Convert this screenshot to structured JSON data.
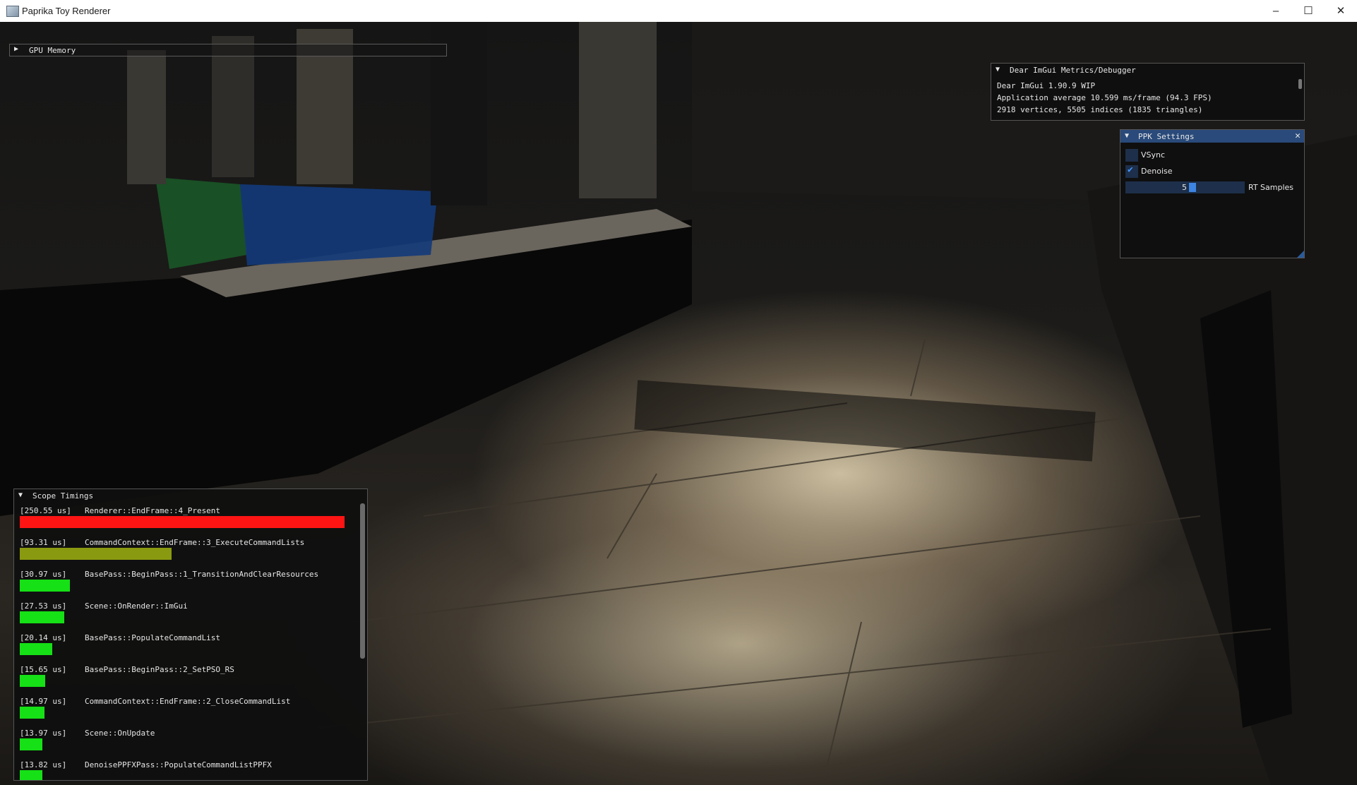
{
  "window": {
    "title": "Paprika Toy Renderer",
    "minimize_glyph": "–",
    "maximize_glyph": "☐",
    "close_glyph": "✕"
  },
  "gpu_memory": {
    "arrow": "▶",
    "label": "GPU Memory"
  },
  "metrics": {
    "arrow": "▼",
    "title": "Dear ImGui Metrics/Debugger",
    "lines": [
      "Dear ImGui 1.90.9 WIP",
      "Application average 10.599 ms/frame (94.3 FPS)",
      "2918 vertices, 5505 indices (1835 triangles)"
    ]
  },
  "ppk_settings": {
    "arrow": "▼",
    "title": "PPK Settings",
    "close": "✕",
    "vsync_label": "VSync",
    "vsync_checked": false,
    "denoise_label": "Denoise",
    "denoise_checked": true,
    "check_glyph": "✔",
    "rt_samples_label": "RT Samples",
    "rt_samples_value": "5"
  },
  "scope_timings": {
    "arrow": "▼",
    "title": "Scope Timings",
    "entries": [
      {
        "time": "[250.55 us]",
        "name": "Renderer::EndFrame::4_Present",
        "fraction": 1.0,
        "color": "#ff1414"
      },
      {
        "time": "[93.31 us]",
        "name": "CommandContext::EndFrame::3_ExecuteCommandLists",
        "fraction": 0.467,
        "color": "#8a9a10"
      },
      {
        "time": "[30.97 us]",
        "name": "BasePass::BeginPass::1_TransitionAndClearResources",
        "fraction": 0.155,
        "color": "#16e016"
      },
      {
        "time": "[27.53 us]",
        "name": "Scene::OnRender::ImGui",
        "fraction": 0.138,
        "color": "#16e016"
      },
      {
        "time": "[20.14 us]",
        "name": "BasePass::PopulateCommandList",
        "fraction": 0.101,
        "color": "#16e016"
      },
      {
        "time": "[15.65 us]",
        "name": "BasePass::BeginPass::2_SetPSO_RS",
        "fraction": 0.078,
        "color": "#16e016"
      },
      {
        "time": "[14.97 us]",
        "name": "CommandContext::EndFrame::2_CloseCommandList",
        "fraction": 0.075,
        "color": "#16e016"
      },
      {
        "time": "[13.97 us]",
        "name": "Scene::OnUpdate",
        "fraction": 0.07,
        "color": "#16e016"
      },
      {
        "time": "[13.82 us]",
        "name": "DenoisePPFXPass::PopulateCommandListPPFX",
        "fraction": 0.069,
        "color": "#16e016"
      }
    ]
  }
}
